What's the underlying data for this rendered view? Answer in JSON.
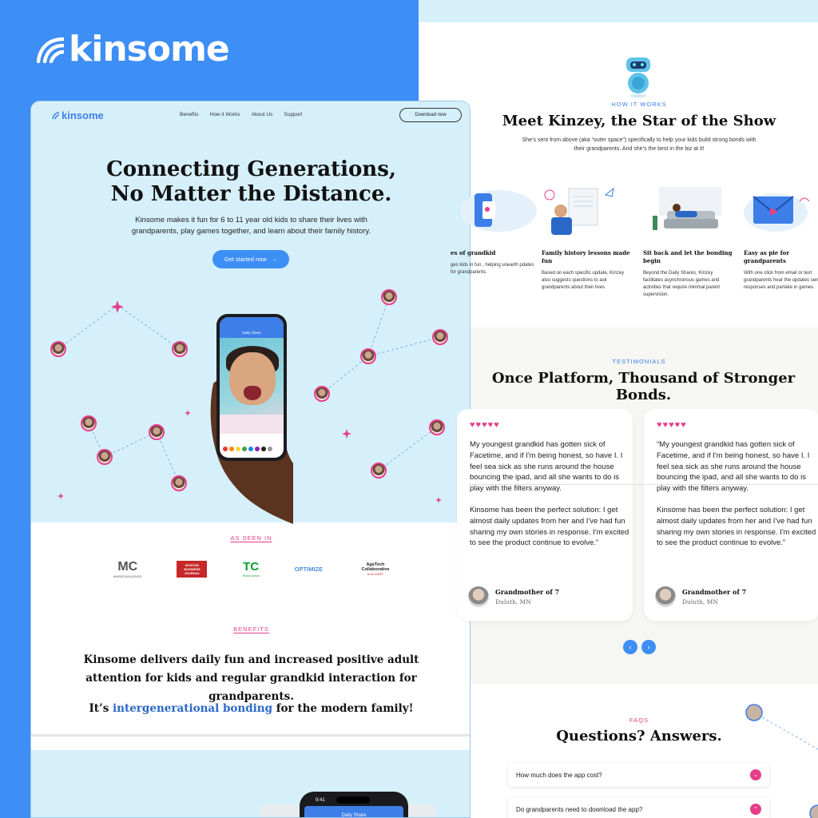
{
  "brand": {
    "name": "kinsome"
  },
  "site": {
    "logo": "kinsome",
    "nav": [
      "Benefits",
      "How it Works",
      "About Us",
      "Support"
    ],
    "download_label": "Download now",
    "hero": {
      "title_line1": "Connecting Generations,",
      "title_line2": "No Matter the Distance.",
      "subtitle": "Kinsome makes it fun for 6 to 11 year old kids to share their lives with grandparents, play games together, and learn about their family history.",
      "cta_label": "Get started now",
      "phone_header": "Daily Share"
    },
    "as_seen_in": {
      "kicker": "AS SEEN IN",
      "logos": [
        {
          "main": "MC",
          "sub": "MASSCHALLENGE"
        },
        {
          "main": "BOSTON BUSINESS JOURNAL",
          "sub": ""
        },
        {
          "main": "TC",
          "sub": "TechCrunch"
        },
        {
          "main": "OPTIMIZE",
          "sub": ""
        },
        {
          "main": "AgeTech Collaborative",
          "sub": "from AARP"
        }
      ]
    },
    "benefits": {
      "kicker": "BENEFITS",
      "text": "Kinsome delivers daily fun and increased positive adult attention for kids and regular grandkid interaction for grandparents.",
      "bonding_prefix": "It’s ",
      "bonding_highlight": "intergenerational bonding",
      "bonding_suffix": " for the modern family!"
    },
    "phone2": {
      "time": "9:41",
      "header": "Daily Share"
    }
  },
  "how_it_works": {
    "kicker": "HOW IT WORKS",
    "title": "Meet Kinzey, the Star of the Show",
    "subtitle": "She’s sent from above (aka “outer space”) specifically to help your kids build strong bonds with their grandparents.  And she’s the best in the biz at it!",
    "features": [
      {
        "title": "es of grandkid",
        "desc": "ges kids in fun , helping unearth pdates for grandparents."
      },
      {
        "title": "Family history lessons made fun",
        "desc": "Based on each specific update, Kinzey also suggests questions to ask grandparents about their lives"
      },
      {
        "title": "Sit back and let the bonding begin",
        "desc": "Beyond the Daily Shares, Kinzey facilitates asynchronous games and activities that require minimal parent supervision."
      },
      {
        "title": "Easy as pie for grandparents",
        "desc": "With one click from email or text grandparents hear the updates send responses and partake in games."
      }
    ]
  },
  "testimonials": {
    "kicker": "TESTIMONIALS",
    "title": "Once Platform, Thousand of Stronger Bonds.",
    "cards": [
      {
        "stars": "♥♥♥♥♥",
        "p1": "My youngest grandkid has gotten sick of Facetime, and if I'm being honest, so have I. I feel sea sick as she runs around the house bouncing the ipad, and all she wants to do is play with the filters anyway.",
        "p2": "Kinsome has been the perfect solution: I get almost daily updates from her and I've had fun sharing my own stories in response.  I'm excited to see the product continue to evolve.”",
        "author": "Grandmother of 7",
        "location": "Duluth, MN"
      },
      {
        "stars": "♥♥♥♥♥",
        "p1": "“My youngest grandkid has gotten sick of Facetime, and if I'm being honest, so have I. I feel sea sick as she runs around the house bouncing the ipad, and all she wants to do is play with the filters anyway.",
        "p2": "Kinsome has been the perfect solution: I get almost daily updates from her and I've had fun sharing my own stories in response.  I'm excited to see the product continue to evolve.”",
        "author": "Grandmother of 7",
        "location": "Duluth, MN"
      }
    ],
    "prev": "‹",
    "next": "›"
  },
  "faq": {
    "kicker": "FAQS",
    "title": "Questions? Answers.",
    "items": [
      {
        "q": "How much does the app cost?",
        "icon": "⌄"
      },
      {
        "q": "Do grandparents need to download the app?",
        "icon": "⌃"
      }
    ]
  },
  "colors": {
    "brand_blue": "#3d8ef5",
    "hero_bg": "#d6f0fb",
    "accent_pink": "#e63e8a",
    "link_blue": "#2a68c8"
  }
}
